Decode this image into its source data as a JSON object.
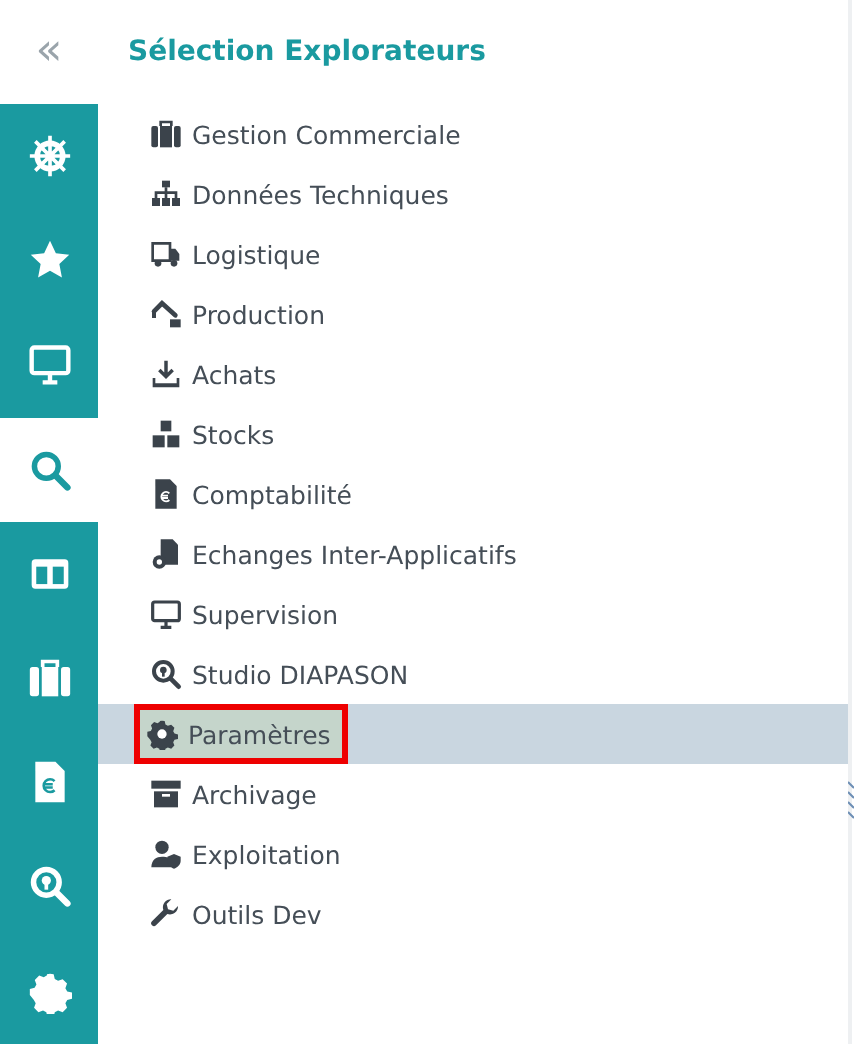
{
  "rail": {
    "collapse": "«",
    "items": [
      {
        "kind": "helm",
        "selected": false
      },
      {
        "kind": "star",
        "selected": false
      },
      {
        "kind": "monitor",
        "selected": false
      },
      {
        "kind": "search",
        "selected": true
      },
      {
        "kind": "columns",
        "selected": false
      },
      {
        "kind": "briefcase",
        "selected": false
      },
      {
        "kind": "invoice",
        "selected": false
      },
      {
        "kind": "pin-search",
        "selected": false
      },
      {
        "kind": "gear",
        "selected": false
      }
    ]
  },
  "panel": {
    "title": "Sélection Explorateurs",
    "items": [
      {
        "label": "Gestion Commerciale",
        "kind": "briefcase",
        "selected": false,
        "outlined": false
      },
      {
        "label": "Données Techniques",
        "kind": "sitemap",
        "selected": false,
        "outlined": false
      },
      {
        "label": "Logistique",
        "kind": "truck",
        "selected": false,
        "outlined": false
      },
      {
        "label": "Production",
        "kind": "robot-arm",
        "selected": false,
        "outlined": false
      },
      {
        "label": "Achats",
        "kind": "download",
        "selected": false,
        "outlined": false
      },
      {
        "label": "Stocks",
        "kind": "boxes",
        "selected": false,
        "outlined": false
      },
      {
        "label": "Comptabilité",
        "kind": "invoice",
        "selected": false,
        "outlined": false
      },
      {
        "label": "Echanges Inter-Applicatifs",
        "kind": "server",
        "selected": false,
        "outlined": false
      },
      {
        "label": "Supervision",
        "kind": "monitor",
        "selected": false,
        "outlined": false
      },
      {
        "label": "Studio DIAPASON",
        "kind": "pin-search",
        "selected": false,
        "outlined": false
      },
      {
        "label": "Paramètres",
        "kind": "gear",
        "selected": true,
        "outlined": true
      },
      {
        "label": "Archivage",
        "kind": "archive",
        "selected": false,
        "outlined": false
      },
      {
        "label": "Exploitation",
        "kind": "user-shield",
        "selected": false,
        "outlined": false
      },
      {
        "label": "Outils Dev",
        "kind": "wrench",
        "selected": false,
        "outlined": false
      }
    ]
  }
}
